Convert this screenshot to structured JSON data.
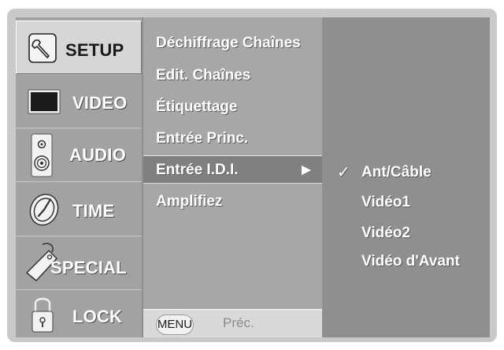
{
  "categories": [
    {
      "label": "SETUP",
      "icon": "wrench-icon"
    },
    {
      "label": "VIDEO",
      "icon": "screen-icon"
    },
    {
      "label": "AUDIO",
      "icon": "speaker-icon"
    },
    {
      "label": "TIME",
      "icon": "clock-icon"
    },
    {
      "label": "SPECIAL",
      "icon": "tag-icon"
    },
    {
      "label": "LOCK",
      "icon": "padlock-icon"
    }
  ],
  "submenu": {
    "items": [
      {
        "label": "Déchiffrage Chaînes"
      },
      {
        "label": "Edit. Chaînes"
      },
      {
        "label": "Étiquettage"
      },
      {
        "label": "Entrée Princ."
      },
      {
        "label": "Entrée I.D.I."
      },
      {
        "label": "Amplifiez"
      }
    ]
  },
  "options": {
    "items": [
      {
        "label": "Ant/Câble",
        "checked": true
      },
      {
        "label": "Vidéo1"
      },
      {
        "label": "Vidéo2"
      },
      {
        "label": "Vidéo d'Avant"
      }
    ]
  },
  "footer": {
    "menu_label": "MENU",
    "back_label": "Préc."
  },
  "colors": {
    "active_category": "#d6d6d6",
    "highlight": "#808080",
    "panel": "#8f8f8f"
  }
}
